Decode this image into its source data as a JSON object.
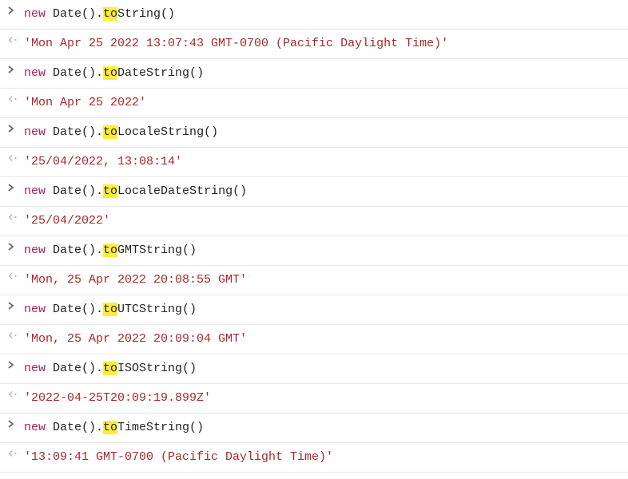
{
  "entries": [
    {
      "kw": "new",
      "obj": " Date().",
      "hl": "to",
      "rest": "String()",
      "out": "'Mon Apr 25 2022 13:07:43 GMT-0700 (Pacific Daylight Time)'"
    },
    {
      "kw": "new",
      "obj": " Date().",
      "hl": "to",
      "rest": "DateString()",
      "out": "'Mon Apr 25 2022'"
    },
    {
      "kw": "new",
      "obj": " Date().",
      "hl": "to",
      "rest": "LocaleString()",
      "out": "'25/04/2022, 13:08:14'"
    },
    {
      "kw": "new",
      "obj": " Date().",
      "hl": "to",
      "rest": "LocaleDateString()",
      "out": "'25/04/2022'"
    },
    {
      "kw": "new",
      "obj": " Date().",
      "hl": "to",
      "rest": "GMTString()",
      "out": "'Mon, 25 Apr 2022 20:08:55 GMT'"
    },
    {
      "kw": "new",
      "obj": " Date().",
      "hl": "to",
      "rest": "UTCString()",
      "out": "'Mon, 25 Apr 2022 20:09:04 GMT'"
    },
    {
      "kw": "new",
      "obj": " Date().",
      "hl": "to",
      "rest": "ISOString()",
      "out": "'2022-04-25T20:09:19.899Z'"
    },
    {
      "kw": "new",
      "obj": " Date().",
      "hl": "to",
      "rest": "TimeString()",
      "out": "'13:09:41 GMT-0700 (Pacific Daylight Time)'"
    }
  ]
}
